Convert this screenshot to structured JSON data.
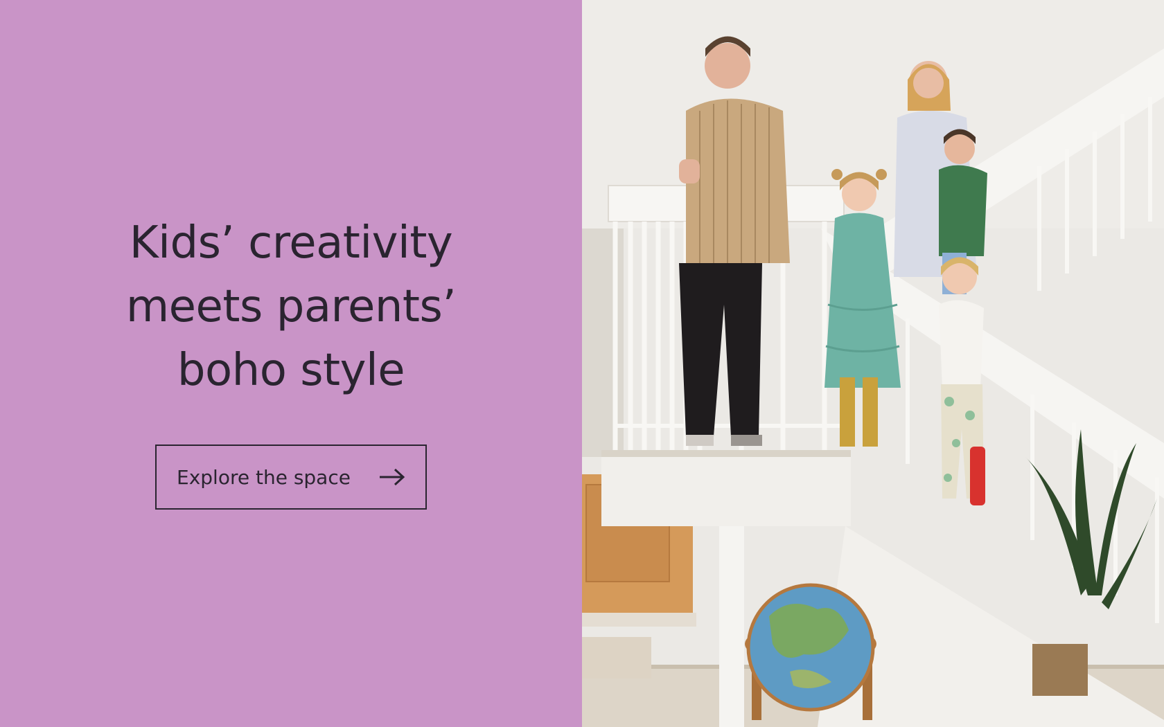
{
  "hero": {
    "headline_lines": [
      "Kids’ creativity",
      "meets parents’",
      "boho style"
    ],
    "cta_label": "Explore the space",
    "cta_icon": "arrow-right-icon",
    "background_color": "#c994c7",
    "text_color": "#2a2430"
  },
  "photo": {
    "subject": "family-on-staircase-photo"
  }
}
